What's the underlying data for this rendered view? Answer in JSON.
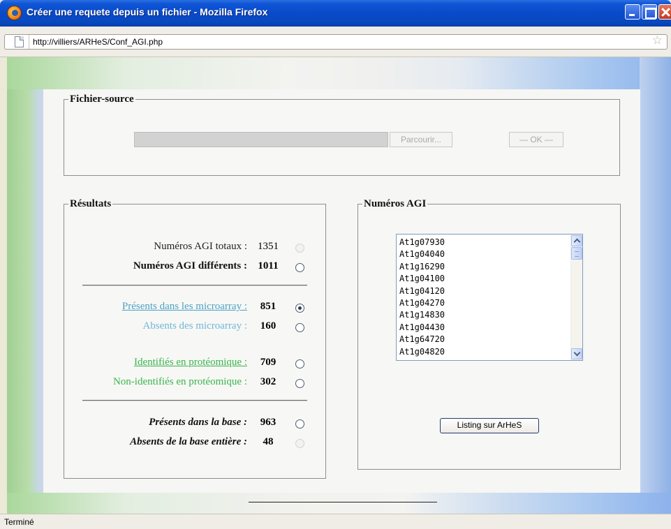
{
  "window": {
    "title": "Créer une requete depuis un fichier - Mozilla Firefox",
    "url": "http://villiers/ARHeS/Conf_AGI.php",
    "status": "Terminé"
  },
  "file_source": {
    "legend": "Fichier-source",
    "browse_label": "Parcourir...",
    "ok_label": "— OK —"
  },
  "results": {
    "legend": "Résultats",
    "rows": [
      {
        "label": "Numéros AGI totaux :",
        "value": "1351",
        "color": "#222222",
        "weight": "normal",
        "italic": false,
        "underline": false,
        "radio": "disabled"
      },
      {
        "label": "Numéros AGI différents :",
        "value": "1011",
        "color": "#111111",
        "weight": "bold",
        "italic": false,
        "underline": false,
        "radio": "enabled"
      },
      {
        "label": "Présents dans les microarray :",
        "value": "851",
        "color": "#4BA3C3",
        "weight": "normal",
        "italic": false,
        "underline": true,
        "radio": "checked"
      },
      {
        "label": "Absents des microarray :",
        "value": "160",
        "color": "#6FB8D6",
        "weight": "normal",
        "italic": false,
        "underline": false,
        "radio": "enabled"
      },
      {
        "label": "Identifiés en protéomique :",
        "value": "709",
        "color": "#39B54A",
        "weight": "normal",
        "italic": false,
        "underline": true,
        "radio": "enabled"
      },
      {
        "label": "Non-identifiés en protéomique :",
        "value": "302",
        "color": "#39B54A",
        "weight": "normal",
        "italic": false,
        "underline": false,
        "radio": "enabled"
      },
      {
        "label": "Présents dans la base :",
        "value": "963",
        "color": "#111111",
        "weight": "bold",
        "italic": true,
        "underline": false,
        "radio": "enabled"
      },
      {
        "label": "Absents de la base entière :",
        "value": "48",
        "color": "#111111",
        "weight": "bold",
        "italic": true,
        "underline": false,
        "radio": "disabled"
      }
    ]
  },
  "agi": {
    "legend": "Numéros AGI",
    "items": [
      "At1g07930",
      "At1g04040",
      "At1g16290",
      "At1g04100",
      "At1g04120",
      "At1g04270",
      "At1g14830",
      "At1g04430",
      "At1g64720",
      "At1g04820"
    ],
    "listing_button": "Listing sur ArHeS"
  },
  "colors": {
    "titlebar": "#0A4AC9",
    "link_blue": "#4BA3C3",
    "proteo_green": "#39B54A"
  }
}
